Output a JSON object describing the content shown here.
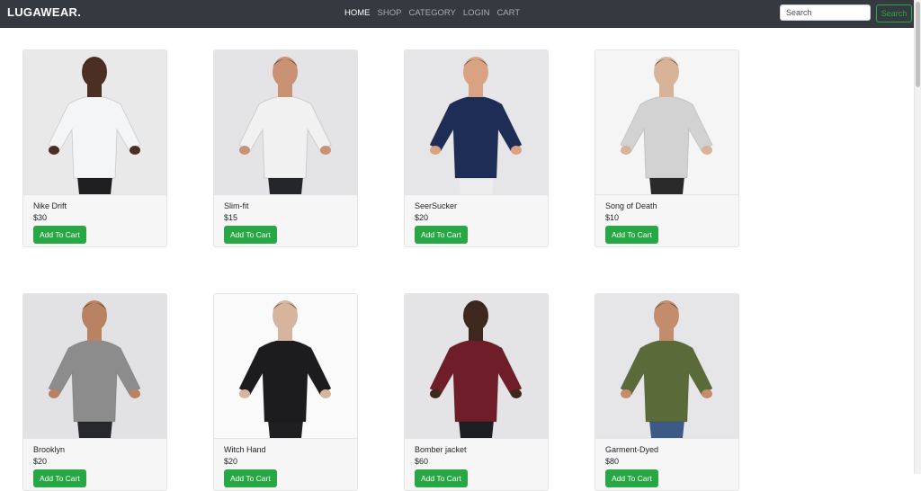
{
  "brand": "LUGAWEAR.",
  "nav": [
    {
      "label": "HOME",
      "active": true
    },
    {
      "label": "SHOP",
      "active": false
    },
    {
      "label": "CATEGORY",
      "active": false
    },
    {
      "label": "LOGIN",
      "active": false
    },
    {
      "label": "CART",
      "active": false
    }
  ],
  "search": {
    "placeholder": "Search",
    "button_label": "Search"
  },
  "colors": {
    "navbar": "#343a40",
    "accent": "#28a745"
  },
  "add_to_cart_label": "Add To Cart",
  "products": [
    {
      "name": "Nike Drift",
      "price": "$30",
      "image": "white t-shirt",
      "bg": "#e9e9ea",
      "shirt": "#f4f5f6",
      "skin": "#4a2f22",
      "pants": "#1e1e20"
    },
    {
      "name": "Slim-fit",
      "price": "$15",
      "image": "palm print shirt",
      "bg": "#e4e4e6",
      "shirt": "#f1f1f1",
      "skin": "#c99275",
      "pants": "#24262a"
    },
    {
      "name": "SeerSucker",
      "price": "$20",
      "image": "navy cloud print shirt",
      "bg": "#e6e6e8",
      "shirt": "#1e2d55",
      "skin": "#d9a383",
      "pants": "#ededed"
    },
    {
      "name": "Song of Death",
      "price": "$10",
      "image": "grey skull t-shirt",
      "bg": "#f5f5f5",
      "shirt": "#d2d2d2",
      "skin": "#d7b39a",
      "pants": "#2a2a2a"
    },
    {
      "name": "Brooklyn",
      "price": "$20",
      "image": "raglan brooklyn tee",
      "bg": "#e2e2e4",
      "shirt": "#8c8c8c",
      "skin": "#b98262",
      "pants": "#26282c"
    },
    {
      "name": "Witch Hand",
      "price": "$20",
      "image": "black hand sweatshirt",
      "bg": "#fafafa",
      "shirt": "#1c1c1e",
      "skin": "#d6b49e",
      "pants": "#1f1f21"
    },
    {
      "name": "Bomber jacket",
      "price": "$60",
      "image": "maroon bomber jacket",
      "bg": "#e4e4e6",
      "shirt": "#6f1d28",
      "skin": "#3e281e",
      "pants": "#1d1e22"
    },
    {
      "name": "Garment-Dyed",
      "price": "$80",
      "image": "olive field jacket",
      "bg": "#e6e6e8",
      "shirt": "#5a6a39",
      "skin": "#c38c6c",
      "pants": "#3d5a86"
    }
  ]
}
